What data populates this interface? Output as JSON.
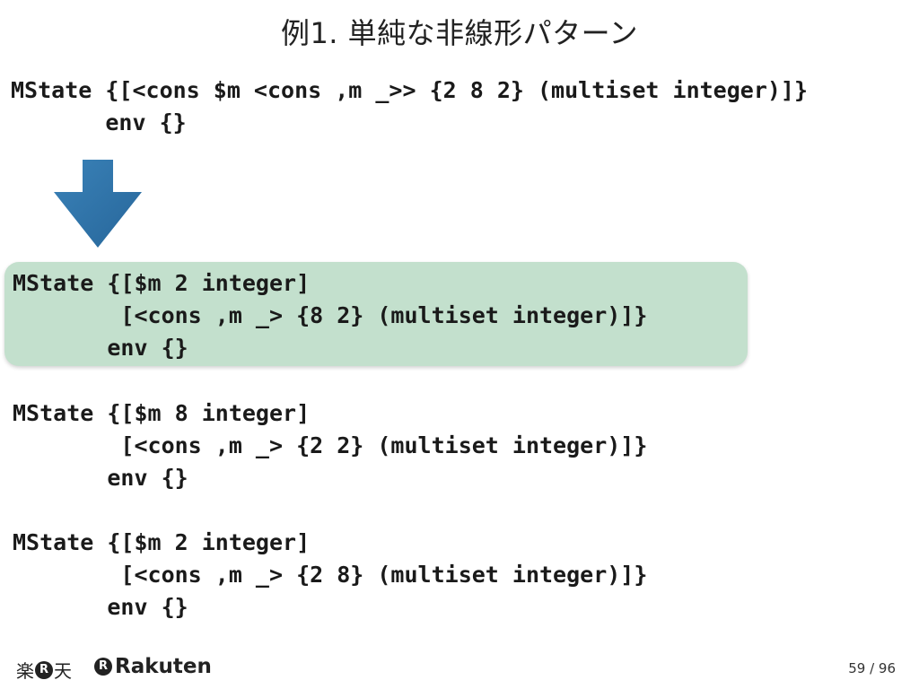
{
  "slide": {
    "title": "例1. 単純な非線形パターン"
  },
  "code_blocks": [
    {
      "lines": [
        "MState {[<cons $m <cons ,m _>> {2 8 2} (multiset integer)]}",
        "       env {}"
      ]
    },
    {
      "highlighted": true,
      "lines": [
        "MState {[$m 2 integer]",
        "        [<cons ,m _> {8 2} (multiset integer)]}",
        "       env {}"
      ]
    },
    {
      "lines": [
        "MState {[$m 8 integer]",
        "        [<cons ,m _> {2 2} (multiset integer)]}",
        "       env {}"
      ]
    },
    {
      "lines": [
        "MState {[$m 2 integer]",
        "        [<cons ,m _> {2 8} (multiset integer)]}",
        "       env {}"
      ]
    }
  ],
  "colors": {
    "arrow": "#2f73a8",
    "highlight": "#c3e0cd"
  },
  "icons": {
    "arrow": "down-arrow-icon"
  },
  "footer": {
    "logo_jp_left": "楽",
    "logo_badge": "R",
    "logo_jp_right": "天",
    "logo_en_text": "Rakuten",
    "page_number": "59 / 96"
  }
}
